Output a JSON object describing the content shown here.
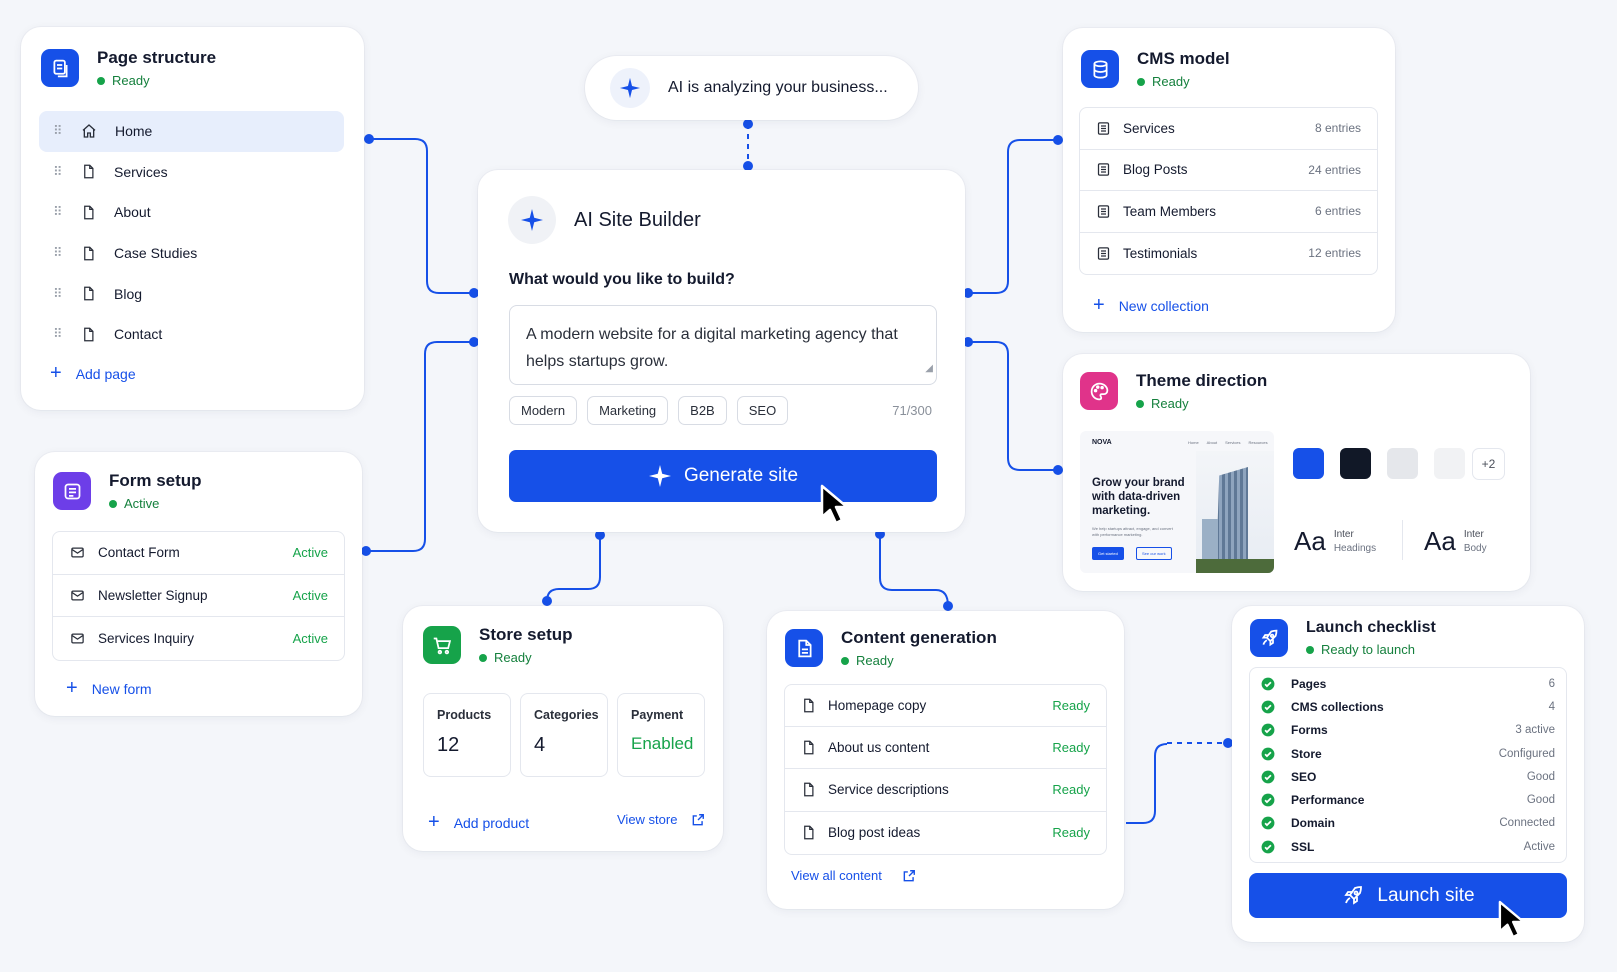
{
  "page_structure": {
    "title": "Page structure",
    "status": "Ready",
    "pages": [
      {
        "label": "Home",
        "icon": "home-icon"
      },
      {
        "label": "Services",
        "icon": "page-icon"
      },
      {
        "label": "About",
        "icon": "page-icon"
      },
      {
        "label": "Case Studies",
        "icon": "page-icon"
      },
      {
        "label": "Blog",
        "icon": "page-icon"
      },
      {
        "label": "Contact",
        "icon": "page-icon"
      }
    ],
    "add_label": "Add page"
  },
  "ai_status": {
    "text": "AI is analyzing your business..."
  },
  "builder": {
    "title": "AI Site Builder",
    "question": "What would you like to build?",
    "prompt": "A modern website for a digital marketing agency that helps startups grow.",
    "tags": [
      "Modern",
      "Marketing",
      "B2B",
      "SEO"
    ],
    "char_count": "71/300",
    "generate_label": "Generate site"
  },
  "cms": {
    "title": "CMS model",
    "status": "Ready",
    "collections": [
      {
        "name": "Services",
        "count": "8 entries"
      },
      {
        "name": "Blog Posts",
        "count": "24 entries"
      },
      {
        "name": "Team Members",
        "count": "6 entries"
      },
      {
        "name": "Testimonials",
        "count": "12 entries"
      }
    ],
    "add_label": "New collection"
  },
  "theme": {
    "title": "Theme direction",
    "status": "Ready",
    "preview": {
      "brand": "NOVA",
      "nav": [
        "Home",
        "About",
        "Services",
        "Resources"
      ],
      "headline": "Grow your brand with data-driven marketing.",
      "body": "We help startups attract, engage, and convert with performance marketing.",
      "cta_primary": "Get started",
      "cta_secondary": "See our work"
    },
    "swatches": [
      "#1650e8",
      "#111827",
      "#e5e7eb",
      "#f1f2f4"
    ],
    "more": "+2",
    "fonts": [
      {
        "sample": "Aa",
        "name": "Inter",
        "role": "Headings"
      },
      {
        "sample": "Aa",
        "name": "Inter",
        "role": "Body"
      }
    ]
  },
  "forms": {
    "title": "Form setup",
    "status": "Active",
    "items": [
      {
        "name": "Contact Form",
        "status": "Active"
      },
      {
        "name": "Newsletter Signup",
        "status": "Active"
      },
      {
        "name": "Services Inquiry",
        "status": "Active"
      }
    ],
    "add_label": "New form"
  },
  "store": {
    "title": "Store setup",
    "status": "Ready",
    "stats": [
      {
        "label": "Products",
        "value": "12"
      },
      {
        "label": "Categories",
        "value": "4"
      },
      {
        "label": "Payment",
        "value": "Enabled"
      }
    ],
    "add_label": "Add product",
    "view_label": "View store"
  },
  "content": {
    "title": "Content generation",
    "status": "Ready",
    "items": [
      {
        "name": "Homepage copy",
        "status": "Ready"
      },
      {
        "name": "About us content",
        "status": "Ready"
      },
      {
        "name": "Service descriptions",
        "status": "Ready"
      },
      {
        "name": "Blog post ideas",
        "status": "Ready"
      }
    ],
    "view_label": "View all content"
  },
  "launch": {
    "title": "Launch checklist",
    "status": "Ready to launch",
    "items": [
      {
        "name": "Pages",
        "value": "6"
      },
      {
        "name": "CMS collections",
        "value": "4"
      },
      {
        "name": "Forms",
        "value": "3 active"
      },
      {
        "name": "Store",
        "value": "Configured"
      },
      {
        "name": "SEO",
        "value": "Good"
      },
      {
        "name": "Performance",
        "value": "Good"
      },
      {
        "name": "Domain",
        "value": "Connected"
      },
      {
        "name": "SSL",
        "value": "Active"
      }
    ],
    "button_label": "Launch site"
  },
  "colors": {
    "accent": "#1650e8",
    "success": "#16a34a",
    "cms_icon": "#1650e8",
    "theme_icon": "#e0338a",
    "form_icon": "#6d3ee8",
    "store_icon": "#16a34a"
  }
}
